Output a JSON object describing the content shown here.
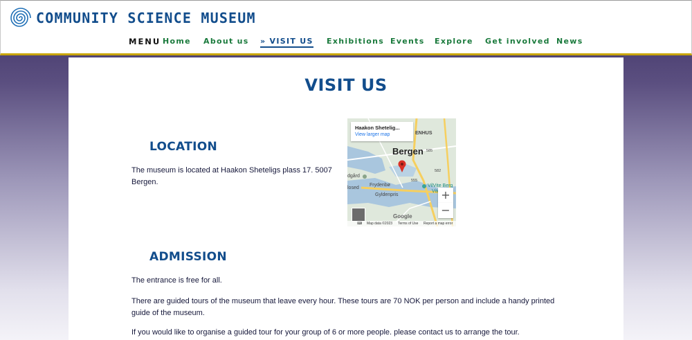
{
  "site": {
    "title": "COMMUNITY SCIENCE MUSEUM",
    "logo_icon": "spiral-logo-icon"
  },
  "nav": {
    "menu_label": "MENU",
    "items": [
      {
        "label": "Home"
      },
      {
        "label": "About us"
      },
      {
        "label": "» VISIT US",
        "active": true
      },
      {
        "label": "Exhibitions"
      },
      {
        "label": "Events"
      },
      {
        "label": "Explore"
      },
      {
        "label": "Get involved"
      },
      {
        "label": "News"
      }
    ]
  },
  "page": {
    "title": "VISIT US",
    "location": {
      "heading": "LOCATION",
      "text": "The museum is located at Haakon Sheteligs plass 17. 5007 Bergen."
    },
    "admission": {
      "heading": "ADMISSION",
      "paragraphs": [
        "The entrance is free for all.",
        "There are guided tours of the museum that leave every hour. These tours are 70 NOK per person and include a handy printed guide of the museum.",
        "If you would like to organise a guided tour for your group of 6 or more people. please contact us to arrange the tour."
      ]
    }
  },
  "map": {
    "place": "Haakon Shetelig...",
    "view_larger": "View larger map",
    "city": "Bergen",
    "labels": [
      "ENHUS",
      "Frydenbø",
      "Gyldenpris",
      "dgård",
      "losed",
      "VilVite Berg",
      "Vitens"
    ],
    "road_labels": [
      "585",
      "555",
      "582"
    ],
    "zoom_in": "+",
    "zoom_out": "−",
    "google": "Google",
    "footer": {
      "keyboard": "⌨",
      "data": "Map data ©2023",
      "terms": "Terms of Use",
      "report": "Report a map error"
    },
    "colors": {
      "water": "#a9c6de",
      "land": "#dfe8dc",
      "road": "#f6cf5f",
      "pin": "#d93025"
    }
  },
  "colors": {
    "brand_blue": "#124d8c",
    "nav_green": "#1a7a3c",
    "accent_gold": "#c8a400",
    "body_text": "#15173a"
  }
}
